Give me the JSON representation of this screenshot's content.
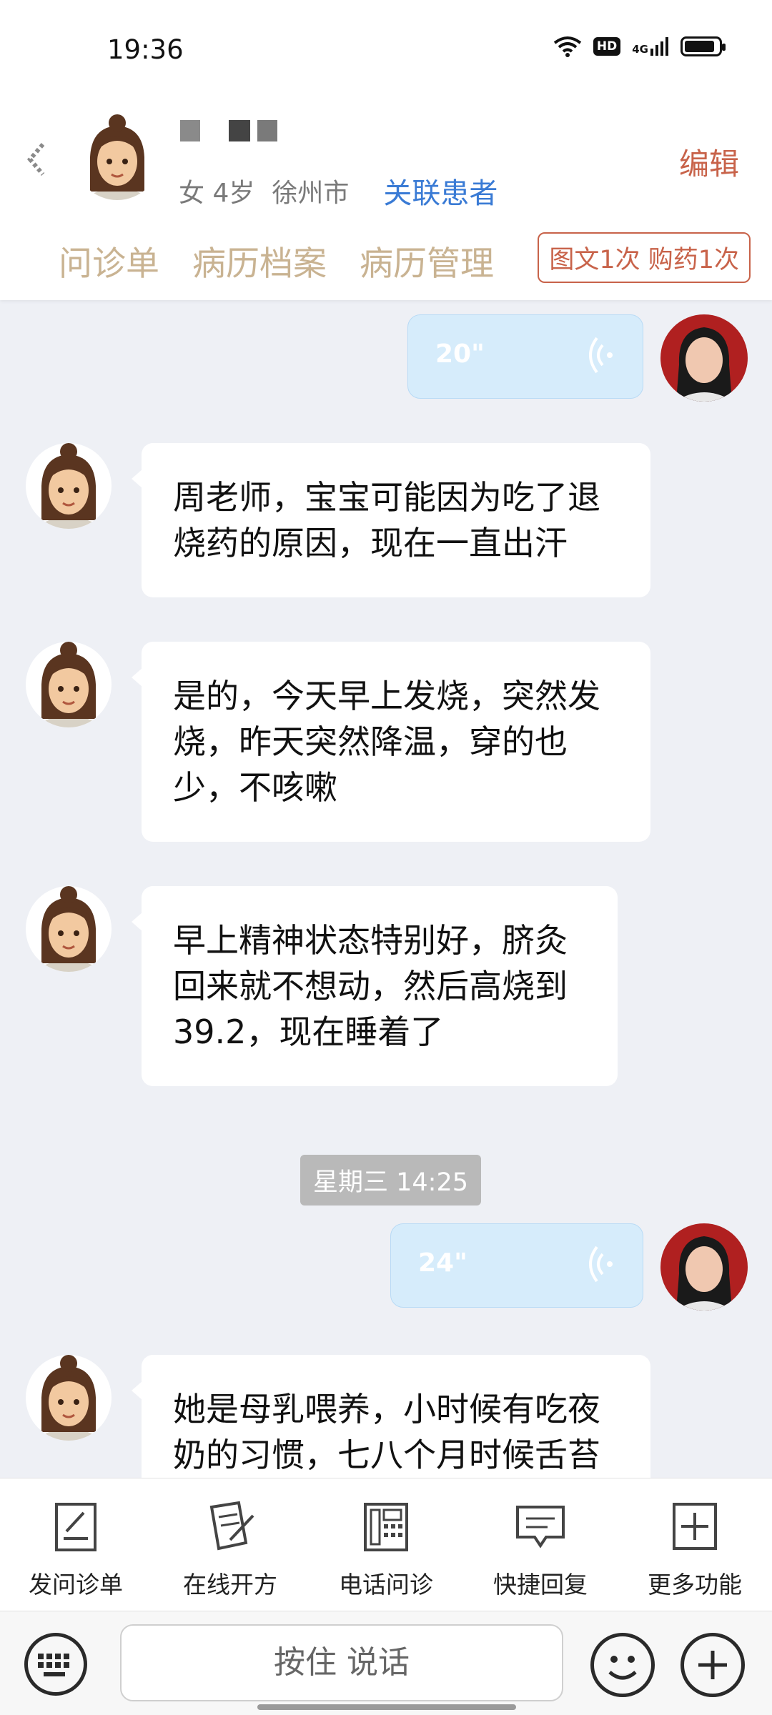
{
  "status_bar": {
    "time": "19:36",
    "hd_badge": "HD",
    "network": "4G",
    "battery_level": 0.9
  },
  "header": {
    "gender_age": "女 4岁",
    "city": "徐州市",
    "link_patient": "关联患者",
    "edit": "编辑",
    "tabs": [
      "问诊单",
      "病历档案",
      "病历管理"
    ],
    "service_tag": "图文1次 购药1次"
  },
  "chat": {
    "voice_messages": [
      {
        "duration": "20\""
      },
      {
        "duration": "24\""
      }
    ],
    "messages": [
      "周老师，宝宝可能因为吃了退烧药的原因，现在一直出汗",
      "是的，今天早上发烧，突然发烧，昨天突然降温，穿的也少，不咳嗽",
      "早上精神状态特别好，脐灸回来就不想动，然后高烧到39.2，现在睡着了",
      "她是母乳喂养，小时候有吃夜奶的习惯，七八个月时候舌苔"
    ],
    "timestamp": "星期三 14:25"
  },
  "toolbar": {
    "items": [
      {
        "label": "发问诊单",
        "icon": "form-icon"
      },
      {
        "label": "在线开方",
        "icon": "prescription-icon"
      },
      {
        "label": "电话问诊",
        "icon": "phone-icon"
      },
      {
        "label": "快捷回复",
        "icon": "quick-reply-icon"
      },
      {
        "label": "更多功能",
        "icon": "more-icon"
      }
    ]
  },
  "input_bar": {
    "hold_to_talk": "按住 说话"
  },
  "colors": {
    "accent_link": "#3a7bd5",
    "edit": "#c8634a",
    "tab": "#c9b392",
    "voice_bubble": "#d6ecfb"
  }
}
